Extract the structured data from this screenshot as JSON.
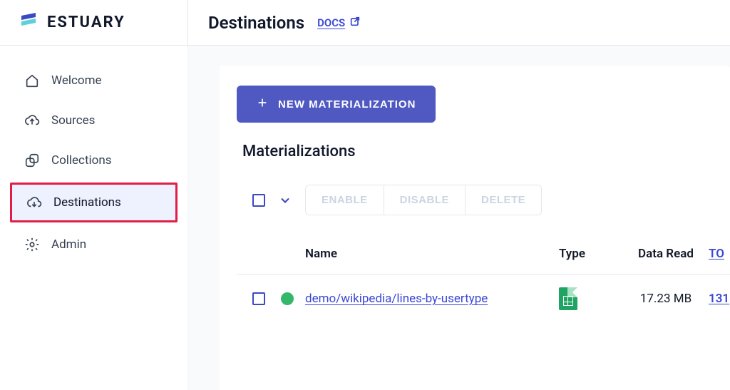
{
  "brand": {
    "name": "ESTUARY"
  },
  "header": {
    "title": "Destinations",
    "docs_label": "DOCS"
  },
  "sidebar": {
    "items": [
      {
        "label": "Welcome"
      },
      {
        "label": "Sources"
      },
      {
        "label": "Collections"
      },
      {
        "label": "Destinations"
      },
      {
        "label": "Admin"
      }
    ]
  },
  "main": {
    "new_button": "NEW MATERIALIZATION",
    "section_title": "Materializations",
    "actions": {
      "enable": "ENABLE",
      "disable": "DISABLE",
      "delete": "DELETE"
    },
    "columns": {
      "name": "Name",
      "type": "Type",
      "data_read": "Data Read",
      "extra": "TO"
    },
    "rows": [
      {
        "name": "demo/wikipedia/lines-by-usertype",
        "data_read": "17.23 MB",
        "extra": "131"
      }
    ]
  }
}
